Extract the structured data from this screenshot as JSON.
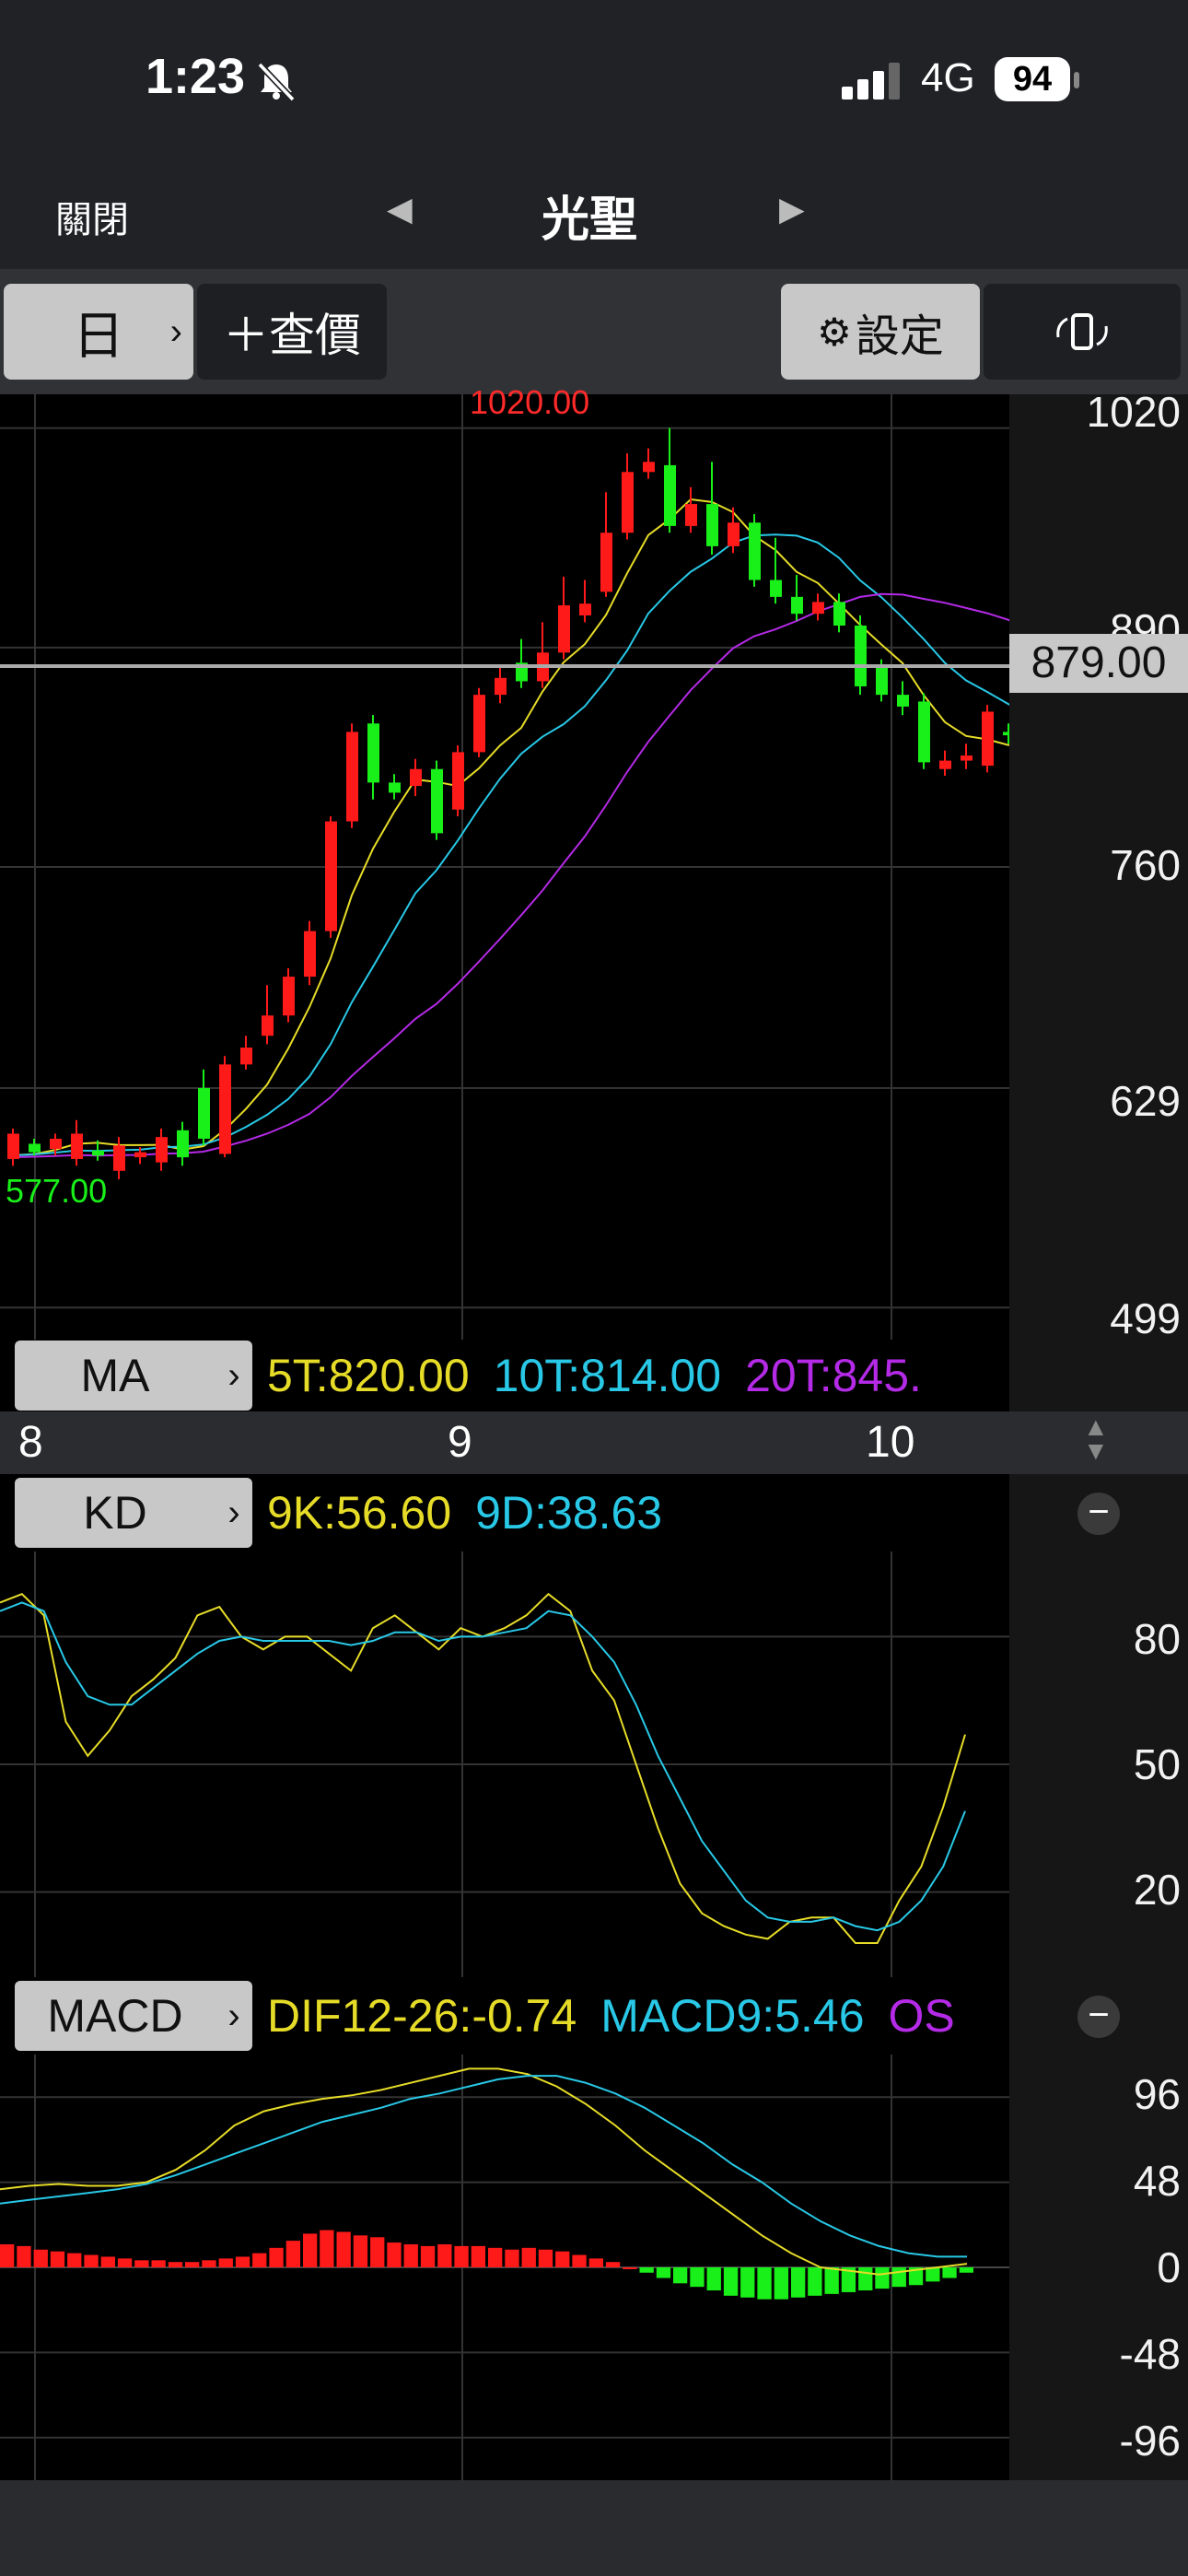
{
  "status_bar": {
    "time": "1:23",
    "network": "4G",
    "battery": "94"
  },
  "nav": {
    "close_label": "關閉",
    "stock_name": "光聖"
  },
  "toolbar": {
    "period_label": "日",
    "query_label": "＋查價",
    "settings_label": "設定"
  },
  "price_chart": {
    "high_label": "1020.00",
    "low_label": "577.00",
    "current_price": "879.00",
    "axis_ticks": [
      "1020",
      "890",
      "760",
      "629",
      "499"
    ],
    "ma_chip": "MA",
    "ma_values": [
      "5T:820.00",
      "10T:814.00",
      "20T:845."
    ],
    "month_labels": [
      "8",
      "9",
      "10"
    ]
  },
  "kd_panel": {
    "chip": "KD",
    "values": [
      "9K:56.60",
      "9D:38.63"
    ],
    "axis_ticks": [
      "80",
      "50",
      "20"
    ]
  },
  "macd_panel": {
    "chip": "MACD",
    "values": [
      "DIF12-26:-0.74",
      "MACD9:5.46",
      "OS"
    ],
    "axis_ticks": [
      "96",
      "48",
      "0",
      "-48",
      "-96"
    ]
  },
  "colors": {
    "up": "#ff1a1a",
    "down": "#19f019",
    "ma5": "#e6dc28",
    "ma10": "#28c8e6",
    "ma20": "#b42ae6"
  },
  "chart_data": [
    {
      "type": "candlestick",
      "title": "",
      "x_labels": [
        "8",
        "9",
        "10"
      ],
      "y_ticks": [
        1020,
        890,
        760,
        629,
        499
      ],
      "ylim": [
        480,
        1040
      ],
      "candles": [
        [
          587,
          602,
          583,
          605
        ],
        [
          596,
          591,
          589,
          599
        ],
        [
          593,
          599,
          589,
          602
        ],
        [
          587,
          602,
          583,
          610
        ],
        [
          592,
          589,
          586,
          598
        ],
        [
          580,
          595,
          575,
          600
        ],
        [
          588,
          591,
          584,
          594
        ],
        [
          585,
          600,
          580,
          605
        ],
        [
          604,
          588,
          583,
          609
        ],
        [
          629,
          599,
          595,
          640
        ],
        [
          590,
          643,
          588,
          648
        ],
        [
          643,
          653,
          640,
          660
        ],
        [
          660,
          672,
          655,
          690
        ],
        [
          672,
          695,
          668,
          700
        ],
        [
          695,
          722,
          690,
          728
        ],
        [
          722,
          787,
          718,
          790
        ],
        [
          787,
          840,
          783,
          845
        ],
        [
          845,
          810,
          800,
          850
        ],
        [
          810,
          804,
          800,
          815
        ],
        [
          808,
          818,
          802,
          824
        ],
        [
          818,
          780,
          776,
          823
        ],
        [
          794,
          828,
          790,
          832
        ],
        [
          828,
          862,
          825,
          866
        ],
        [
          862,
          872,
          857,
          878
        ],
        [
          881,
          870,
          866,
          895
        ],
        [
          870,
          887,
          866,
          905
        ],
        [
          887,
          915,
          883,
          932
        ],
        [
          909,
          916,
          905,
          930
        ],
        [
          923,
          958,
          920,
          982
        ],
        [
          958,
          994,
          954,
          1005
        ],
        [
          994,
          1000,
          990,
          1008
        ],
        [
          998,
          962,
          958,
          1020
        ],
        [
          962,
          975,
          958,
          985
        ],
        [
          975,
          950,
          945,
          1000
        ],
        [
          950,
          964,
          946,
          973
        ],
        [
          964,
          930,
          926,
          969
        ],
        [
          930,
          920,
          916,
          955
        ],
        [
          920,
          910,
          906,
          933
        ],
        [
          910,
          917,
          906,
          922
        ],
        [
          917,
          903,
          899,
          922
        ],
        [
          903,
          867,
          862,
          909
        ],
        [
          878,
          862,
          858,
          883
        ],
        [
          862,
          855,
          850,
          870
        ],
        [
          858,
          822,
          818,
          863
        ],
        [
          818,
          823,
          814,
          829
        ],
        [
          823,
          826,
          818,
          833
        ],
        [
          820,
          852,
          816,
          856
        ],
        [
          840,
          838,
          833,
          845
        ],
        [
          838,
          840,
          834,
          846
        ],
        [
          840,
          790,
          785,
          846
        ],
        [
          790,
          776,
          758,
          795
        ],
        [
          786,
          804,
          760,
          809
        ],
        [
          804,
          806,
          800,
          811
        ],
        [
          808,
          803,
          799,
          813
        ],
        [
          805,
          815,
          801,
          820
        ],
        [
          815,
          840,
          811,
          845
        ],
        [
          840,
          879,
          836,
          907
        ]
      ],
      "series": [
        {
          "name": "5T",
          "values": []
        },
        {
          "name": "10T",
          "values": []
        },
        {
          "name": "20T",
          "values": []
        }
      ],
      "grid": true
    },
    {
      "type": "line",
      "title": "",
      "ylim": [
        0,
        100
      ],
      "y_ticks": [
        80,
        50,
        20
      ],
      "series": [
        {
          "name": "9K",
          "values": [
            88,
            90,
            85,
            60,
            52,
            58,
            66,
            70,
            75,
            85,
            87,
            80,
            77,
            80,
            80,
            76,
            72,
            82,
            85,
            81,
            77,
            82,
            80,
            82,
            85,
            90,
            86,
            72,
            65,
            50,
            35,
            22,
            15,
            12,
            10,
            9,
            13,
            14,
            14,
            8,
            8,
            18,
            26,
            40,
            57
          ]
        },
        {
          "name": "9D",
          "values": [
            86,
            88,
            86,
            74,
            66,
            64,
            64,
            68,
            72,
            76,
            79,
            80,
            79,
            79,
            79,
            79,
            78,
            79,
            81,
            81,
            79,
            80,
            80,
            81,
            82,
            86,
            85,
            80,
            74,
            64,
            52,
            42,
            32,
            25,
            18,
            14,
            13,
            13,
            14,
            12,
            11,
            13,
            18,
            26,
            39
          ]
        }
      ],
      "grid": true
    },
    {
      "type": "bar",
      "title": "",
      "ylim": [
        -120,
        120
      ],
      "y_ticks": [
        96,
        48,
        0,
        -48,
        -96
      ],
      "series": [
        {
          "name": "DIF",
          "values": [
            44,
            46,
            47,
            46,
            46,
            48,
            55,
            66,
            80,
            88,
            92,
            95,
            97,
            100,
            104,
            108,
            112,
            112,
            109,
            102,
            92,
            80,
            66,
            54,
            42,
            30,
            18,
            8,
            0,
            -2,
            -4,
            -2,
            0,
            2
          ]
        },
        {
          "name": "MACD9",
          "values": [
            36,
            38,
            40,
            42,
            44,
            47,
            52,
            58,
            64,
            70,
            76,
            82,
            86,
            90,
            95,
            98,
            102,
            106,
            108,
            108,
            104,
            98,
            90,
            80,
            70,
            58,
            48,
            36,
            26,
            18,
            12,
            8,
            6,
            6
          ]
        },
        {
          "name": "OSC",
          "values": [
            13,
            12,
            10,
            9,
            8,
            7,
            6,
            5,
            4,
            4,
            3,
            3,
            4,
            5,
            6,
            8,
            11,
            15,
            19,
            21,
            20,
            18,
            17,
            14,
            13,
            12,
            13,
            12,
            12,
            11,
            10,
            11,
            10,
            9,
            7,
            5,
            3,
            0,
            -3,
            -6,
            -9,
            -11,
            -13,
            -16,
            -17,
            -18,
            -18,
            -17,
            -16,
            -15,
            -14,
            -13,
            -12,
            -11,
            -10,
            -8,
            -6,
            -3
          ]
        }
      ],
      "grid": true
    }
  ]
}
